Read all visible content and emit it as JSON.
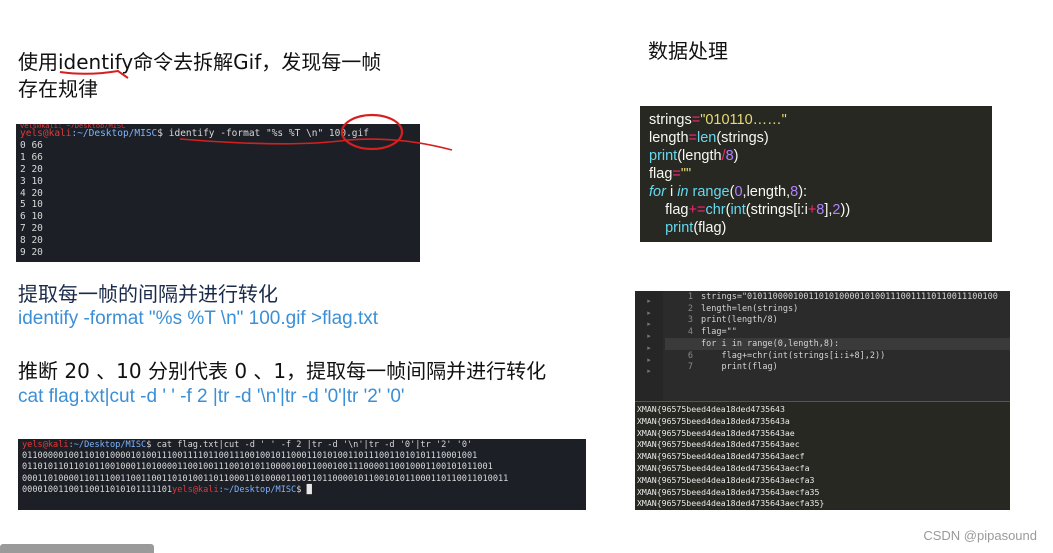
{
  "left": {
    "heading1_line1_a": "使用",
    "heading1_cmd": "identify",
    "heading1_line1_b": "命令去拆解Gif，发现每一帧",
    "heading1_line2": "存在规律",
    "term1": {
      "top_partial": "yels@kali: ~/Desktop/MISC",
      "prompt_user": "yels@kali",
      "prompt_path": ":~/Desktop/MISC",
      "prompt_dollar": "$",
      "command": "identify -format \"%s %T \\n\"",
      "command_file": "100.gif",
      "output": [
        "0 66",
        "1 66",
        "2 20",
        "3 10",
        "4 20",
        "5 10",
        "6 10",
        "7 20",
        "8 20",
        "9 20"
      ]
    },
    "heading2": "提取每一帧的间隔并进行转化",
    "cmd2": "identify -format \"%s %T \\n\" 100.gif >flag.txt",
    "heading3": "推断 20 、10 分别代表 0 、1，提取每一帧间隔并进行转化",
    "cmd3": "cat flag.txt|cut -d ' ' -f 2 |tr -d '\\n'|tr -d '0'|tr '2' '0'",
    "term2": {
      "prompt_user": "yels@kali",
      "prompt_path": ":~/Desktop/MISC",
      "prompt_dollar": "$",
      "command": "cat flag.txt|cut -d ' ' -f 2 |tr -d '\\n'|tr -d '0'|tr '2' '0'",
      "output": [
        "0110000010011010100001010011100111101100111001001011000110101001101110011010101110001001",
        "0110101101101011001000110100001100100111001010110000100110001001110000110010001100101011001",
        "0001101000011011100110011001101010011011000110100001100110110000101100101011000110110011010011",
        "00001001100110011010101111101"
      ],
      "end_user": "yels@kali",
      "end_path": ":~/Desktop/MISC",
      "end_dollar": "$"
    }
  },
  "right": {
    "heading": "数据处理",
    "code_block": {
      "lines": [
        {
          "parts": [
            {
              "t": "strings",
              "c": "plain"
            },
            {
              "t": "=",
              "c": "op"
            },
            {
              "t": "\"010110……\"",
              "c": "str"
            }
          ]
        },
        {
          "parts": [
            {
              "t": "length",
              "c": "plain"
            },
            {
              "t": "=",
              "c": "op"
            },
            {
              "t": "len",
              "c": "fn"
            },
            {
              "t": "(strings)",
              "c": "plain"
            }
          ]
        },
        {
          "parts": [
            {
              "t": "print",
              "c": "fn"
            },
            {
              "t": "(length",
              "c": "plain"
            },
            {
              "t": "/",
              "c": "op"
            },
            {
              "t": "8",
              "c": "num"
            },
            {
              "t": ")",
              "c": "plain"
            }
          ]
        },
        {
          "parts": [
            {
              "t": "flag",
              "c": "plain"
            },
            {
              "t": "=",
              "c": "op"
            },
            {
              "t": "\"\"",
              "c": "str"
            }
          ]
        },
        {
          "parts": [
            {
              "t": "for",
              "c": "kw"
            },
            {
              "t": " i ",
              "c": "plain"
            },
            {
              "t": "in",
              "c": "kw"
            },
            {
              "t": " range",
              "c": "fn"
            },
            {
              "t": "(",
              "c": "plain"
            },
            {
              "t": "0",
              "c": "num"
            },
            {
              "t": ",length,",
              "c": "plain"
            },
            {
              "t": "8",
              "c": "num"
            },
            {
              "t": "):",
              "c": "plain"
            }
          ]
        },
        {
          "parts": [
            {
              "t": "    flag",
              "c": "plain"
            },
            {
              "t": "+=",
              "c": "op"
            },
            {
              "t": "chr",
              "c": "fn"
            },
            {
              "t": "(",
              "c": "plain"
            },
            {
              "t": "int",
              "c": "fn"
            },
            {
              "t": "(strings[i:i",
              "c": "plain"
            },
            {
              "t": "+",
              "c": "op"
            },
            {
              "t": "8",
              "c": "num"
            },
            {
              "t": "],",
              "c": "plain"
            },
            {
              "t": "2",
              "c": "num"
            },
            {
              "t": "))",
              "c": "plain"
            }
          ]
        },
        {
          "parts": [
            {
              "t": "    print",
              "c": "fn"
            },
            {
              "t": "(flag)",
              "c": "plain"
            }
          ]
        }
      ]
    },
    "editor": {
      "line_numbers": [
        "1",
        "2",
        "3",
        "4",
        "5",
        "6",
        "7"
      ],
      "lines": [
        "strings=\"0101100001001101010000101001110011110110011100100",
        "length=len(strings)",
        "print(length/8)",
        "flag=\"\"",
        "for i in range(0,length,8):",
        "    flag+=chr(int(strings[i:i+8],2))",
        "    print(flag)"
      ],
      "output": [
        "XMAN{96575beed4dea18ded4735643",
        "XMAN{96575beed4dea18ded4735643a",
        "XMAN{96575beed4dea18ded4735643ae",
        "XMAN{96575beed4dea18ded4735643aec",
        "XMAN{96575beed4dea18ded4735643aecf",
        "XMAN{96575beed4dea18ded4735643aecfa",
        "XMAN{96575beed4dea18ded4735643aecfa3",
        "XMAN{96575beed4dea18ded4735643aecfa35",
        "XMAN{96575beed4dea18ded4735643aecfa35}"
      ]
    }
  },
  "watermark": "CSDN @pipasound",
  "colors": {
    "accent_blue": "#3b8fd6",
    "prompt_red": "#e03a3a",
    "annotation_red": "#d62020"
  }
}
